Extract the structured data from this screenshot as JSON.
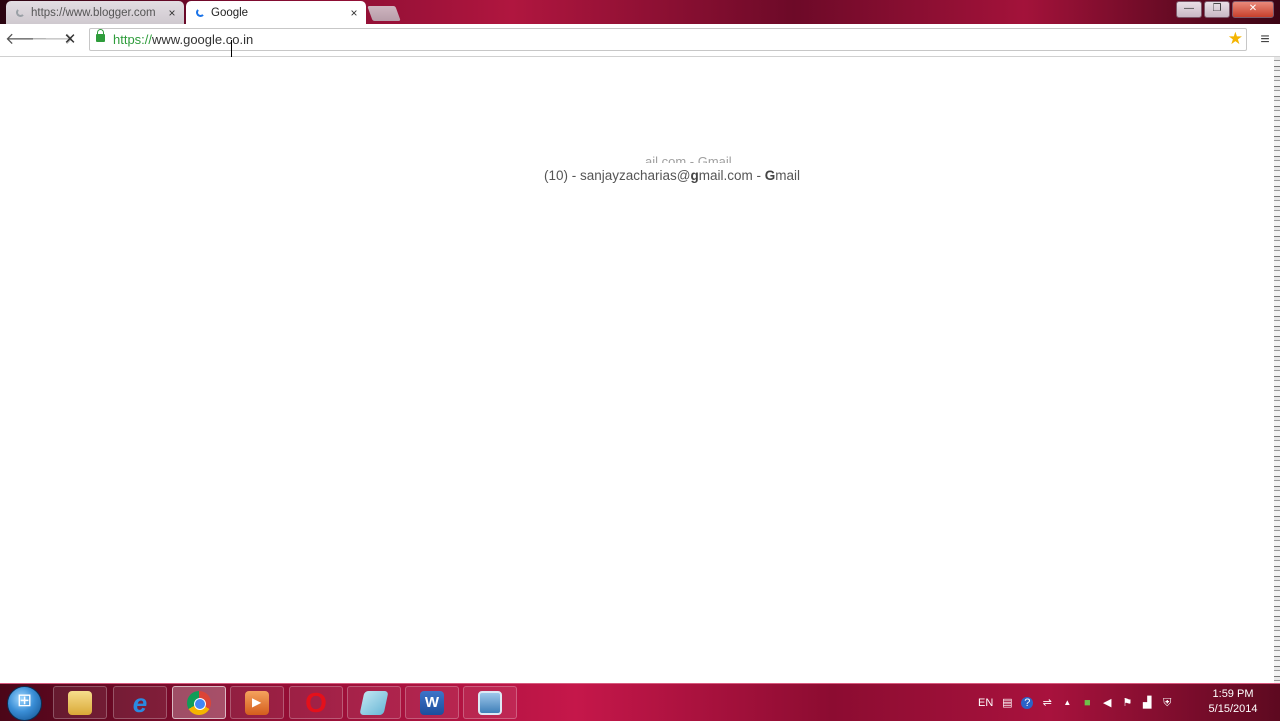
{
  "browser": {
    "tabs": [
      {
        "title": "https://www.blogger.com",
        "state": "inactive",
        "loading": true
      },
      {
        "title": "Google",
        "state": "active",
        "loading": true
      }
    ],
    "tab_close_glyph": "×",
    "window_buttons": {
      "minimize": "—",
      "maximize": "❐",
      "close": "✕"
    },
    "back_glyph": "🡐",
    "forward_glyph": "🡒",
    "stop_glyph": "✕",
    "address": {
      "scheme": "https://",
      "host": "www.google.co.in"
    },
    "bookmark_glyph": "★",
    "menu_glyph": "≡"
  },
  "page": {
    "ghost_text": "ail.com - Gmail",
    "account_prefix": "(10) - sanjayzacharias@",
    "account_bold_g": "g",
    "account_mid": "mail.com - ",
    "account_bold_g2": "G",
    "account_suffix": "mail"
  },
  "taskbar": {
    "apps": [
      "windows-explorer",
      "internet-explorer",
      "google-chrome",
      "media-player",
      "opera",
      "sticky-notes",
      "microsoft-word",
      "snipping-tool"
    ],
    "active_app": "google-chrome",
    "ie_glyph": "e",
    "opera_glyph": "O",
    "word_glyph": "W",
    "language": "EN",
    "tray_icons": [
      "document-icon",
      "help-icon",
      "network-adapter-icon",
      "show-hidden-icons-chevron",
      "colored-app-icon",
      "volume-icon",
      "action-center-flag-icon",
      "signal-icon",
      "security-icon"
    ],
    "tray_glyphs": {
      "doc": "▤",
      "help": "?",
      "net": "⇌",
      "chevron": "▲",
      "app": "■",
      "volume": "◀",
      "flag": "⚑",
      "signal": "▟",
      "shield": "⛨"
    },
    "time": "1:59 PM",
    "date": "5/15/2014"
  },
  "colors": {
    "secure_green": "#2e9c3b",
    "star_yellow": "#f4b400",
    "taskbar_red": "#a8123d"
  }
}
